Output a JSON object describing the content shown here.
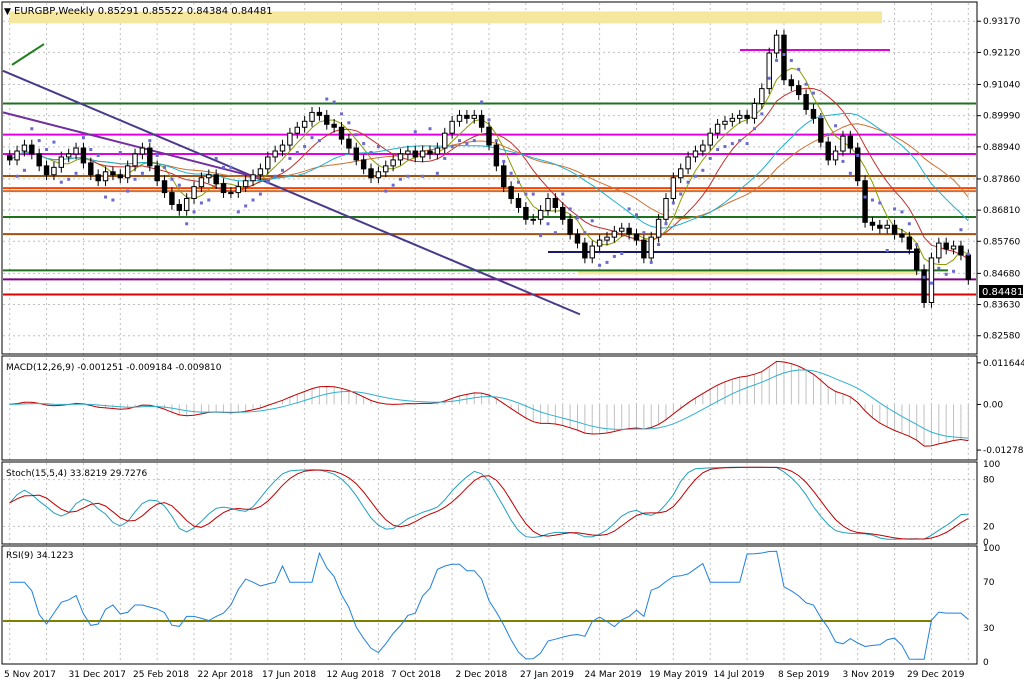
{
  "header": {
    "symbol": "EURGBP,Weekly",
    "ohlc": "0.85291 0.85522 0.84384 0.84481"
  },
  "colors": {
    "bull_candle": "#ffffff",
    "bear_candle": "#000000",
    "grid": "#c0c0c0",
    "macd_main": "#c0c0c0",
    "macd_signal": "#30b0d0",
    "macd_red": "#c00000",
    "stoch_main": "#20a0c0",
    "stoch_signal": "#c00000",
    "rsi": "#2080e0",
    "rsi_level": "#808000",
    "psar": "#6a6ad0",
    "ma_fast": "#8a9a00",
    "ma_mid": "#c03030",
    "ma_slow": "#d07030",
    "ma_long": "#20b0d0",
    "trendline": "#4a3a8a"
  },
  "chart_data": [
    {
      "type": "candlestick",
      "title": "EURGBP,Weekly",
      "ylim": [
        0.821,
        0.9375
      ],
      "y_ticks": [
        "0.93170",
        "0.92120",
        "0.91040",
        "0.89990",
        "0.88940",
        "0.87860",
        "0.86810",
        "0.85760",
        "0.84680",
        "0.83630",
        "0.82580"
      ],
      "x_ticks": [
        "5 Nov 2017",
        "31 Dec 2017",
        "25 Feb 2018",
        "22 Apr 2018",
        "17 Jun 2018",
        "12 Aug 2018",
        "7 Oct 2018",
        "2 Dec 2018",
        "27 Jan 2019",
        "24 Mar 2019",
        "19 May 2019",
        "14 Jul 2019",
        "8 Sep 2019",
        "3 Nov 2019",
        "29 Dec 2019"
      ],
      "current_price_label": "0.84481",
      "closes": [
        0.885,
        0.888,
        0.89,
        0.887,
        0.883,
        0.88,
        0.8825,
        0.886,
        0.887,
        0.889,
        0.884,
        0.88,
        0.878,
        0.881,
        0.88,
        0.879,
        0.883,
        0.887,
        0.889,
        0.883,
        0.878,
        0.874,
        0.87,
        0.868,
        0.872,
        0.876,
        0.879,
        0.88,
        0.877,
        0.874,
        0.874,
        0.876,
        0.878,
        0.88,
        0.882,
        0.886,
        0.888,
        0.89,
        0.894,
        0.896,
        0.898,
        0.901,
        0.9,
        0.897,
        0.896,
        0.892,
        0.889,
        0.885,
        0.882,
        0.879,
        0.881,
        0.883,
        0.885,
        0.887,
        0.888,
        0.886,
        0.888,
        0.887,
        0.889,
        0.894,
        0.898,
        0.9,
        0.899,
        0.9,
        0.896,
        0.89,
        0.883,
        0.876,
        0.872,
        0.869,
        0.865,
        0.865,
        0.868,
        0.872,
        0.869,
        0.865,
        0.86,
        0.857,
        0.852,
        0.856,
        0.858,
        0.859,
        0.861,
        0.862,
        0.86,
        0.858,
        0.852,
        0.859,
        0.865,
        0.872,
        0.879,
        0.882,
        0.886,
        0.888,
        0.89,
        0.894,
        0.897,
        0.898,
        0.899,
        0.9,
        0.899,
        0.904,
        0.909,
        0.921,
        0.927,
        0.912,
        0.91,
        0.907,
        0.902,
        0.899,
        0.891,
        0.885,
        0.888,
        0.893,
        0.889,
        0.878,
        0.864,
        0.863,
        0.862,
        0.863,
        0.86,
        0.859,
        0.855,
        0.848,
        0.837,
        0.852,
        0.857,
        0.855,
        0.856,
        0.853,
        0.8448
      ]
    },
    {
      "type": "line",
      "title": "MACD(12,26,9) -0.001251 -0.009184 -0.009810",
      "ylim": [
        -0.015,
        0.013
      ],
      "y_ticks": [
        "0.011644",
        "0.00",
        "-0.012781"
      ]
    },
    {
      "type": "line",
      "title": "Stoch(15,5,4) 33.8219 29.7276",
      "ylim": [
        0,
        100
      ],
      "y_ticks": [
        "100",
        "80",
        "20",
        "0"
      ]
    },
    {
      "type": "line",
      "title": "RSI(9) 34.1223",
      "ylim": [
        0,
        100
      ],
      "y_ticks": [
        "100",
        "70",
        "30",
        "0"
      ]
    }
  ]
}
